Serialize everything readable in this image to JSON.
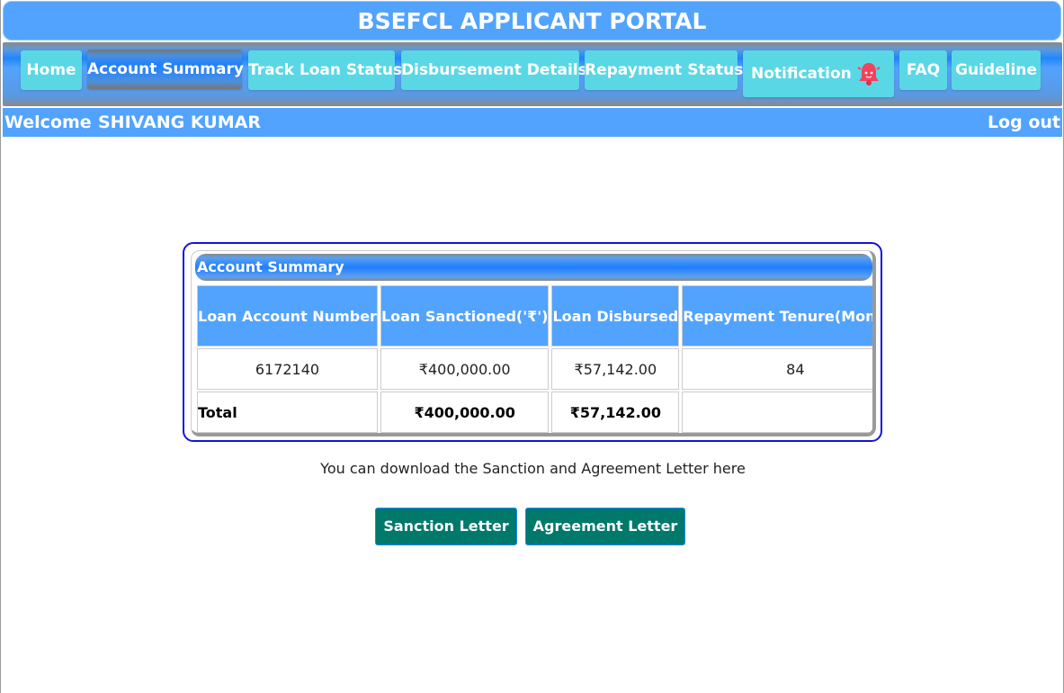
{
  "header": {
    "title": "BSEFCL APPLICANT PORTAL"
  },
  "nav": {
    "items": [
      {
        "label": "Home"
      },
      {
        "label": "Account Summary",
        "active": true
      },
      {
        "label": "Track Loan Status"
      },
      {
        "label": "Disbursement Details"
      },
      {
        "label": "Repayment Status"
      },
      {
        "label": "Notification",
        "icon": "bell-icon"
      },
      {
        "label": "FAQ"
      },
      {
        "label": "Guideline"
      }
    ]
  },
  "welcome": {
    "label": "Welcome",
    "name": "SHIVANG KUMAR",
    "logout": "Log out"
  },
  "summary": {
    "title": "Account Summary",
    "columns": [
      "Loan Account Number",
      "Loan Sanctioned('₹')",
      "Loan Disbursed",
      "Repayment Tenure(Months)"
    ],
    "rows": [
      {
        "account": "6172140",
        "sanctioned": "₹400,000.00",
        "disbursed": "₹57,142.00",
        "tenure": "84"
      }
    ],
    "total": {
      "label": "Total",
      "sanctioned": "₹400,000.00",
      "disbursed": "₹57,142.00"
    }
  },
  "download": {
    "text": "You can download the Sanction and Agreement Letter here",
    "sanction_label": "Sanction Letter",
    "agreement_label": "Agreement Letter"
  },
  "colors": {
    "primary": "#52a3fe",
    "nav_button": "#5ad7e4",
    "action_button": "#00796b",
    "box_border": "#1414d9"
  }
}
